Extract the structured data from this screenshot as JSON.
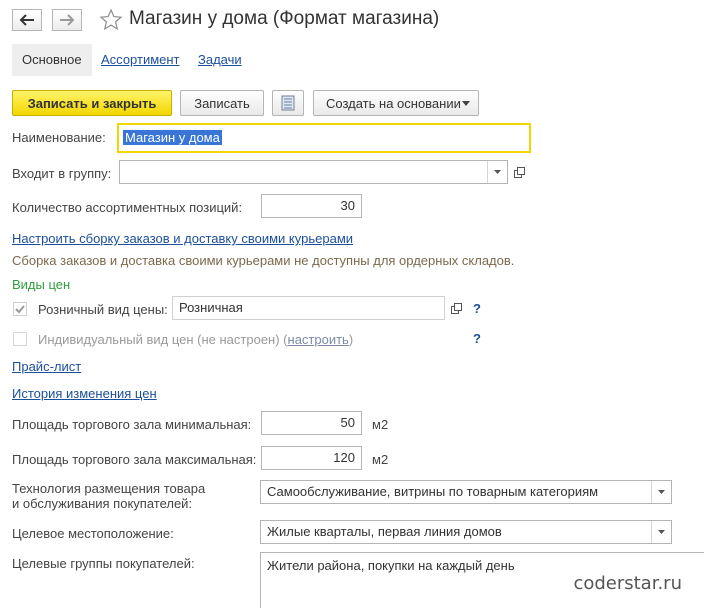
{
  "window": {
    "title": "Магазин у дома (Формат магазина)"
  },
  "tabs": [
    {
      "label": "Основное"
    },
    {
      "label": "Ассортимент"
    },
    {
      "label": "Задачи"
    }
  ],
  "toolbar": {
    "save_close_label": "Записать и закрыть",
    "save_label": "Записать",
    "create_based_label": "Создать на основании"
  },
  "form": {
    "name_label": "Наименование:",
    "name_value": "Магазин у дома",
    "group_label": "Входит в группу:",
    "group_value": "",
    "assortment_count_label": "Количество ассортиментных позиций:",
    "assortment_count_value": "30",
    "configure_link": "Настроить сборку заказов и доставку своими курьерами",
    "info_text": "Сборка заказов и доставка своими курьерами не доступны для ордерных складов.",
    "price_types_header": "Виды цен",
    "retail_price_label": "Розничный вид цены:",
    "retail_price_value": "Розничная",
    "individual_price_label": "Индивидуальный вид цен (не настроен) (",
    "individual_price_link": "настроить",
    "individual_price_close": ")",
    "help_mark": "?",
    "price_list_link": "Прайс-лист",
    "price_history_link": "История изменения цен",
    "area_min_label": "Площадь торгового зала минимальная:",
    "area_min_value": "50",
    "area_max_label": "Площадь торгового зала максимальная:",
    "area_max_value": "120",
    "area_unit": "м2",
    "technology_label_1": "Технология размещения товара",
    "technology_label_2": "и обслуживания покупателей:",
    "technology_value": "Самообслуживание, витрины по товарным категориям",
    "location_label": "Целевое местоположение:",
    "location_value": "Жилые кварталы, первая линия домов",
    "customer_groups_label": "Целевые группы покупателей:",
    "customer_groups_value": "Жители района, покупки на каждый день"
  },
  "colors": {
    "accent_yellow": "#f2d600",
    "link_blue": "#1b4f9c",
    "section_green": "#2e9e3e",
    "info_brown": "#7a6a4e"
  },
  "watermark": "coderstar.ru"
}
